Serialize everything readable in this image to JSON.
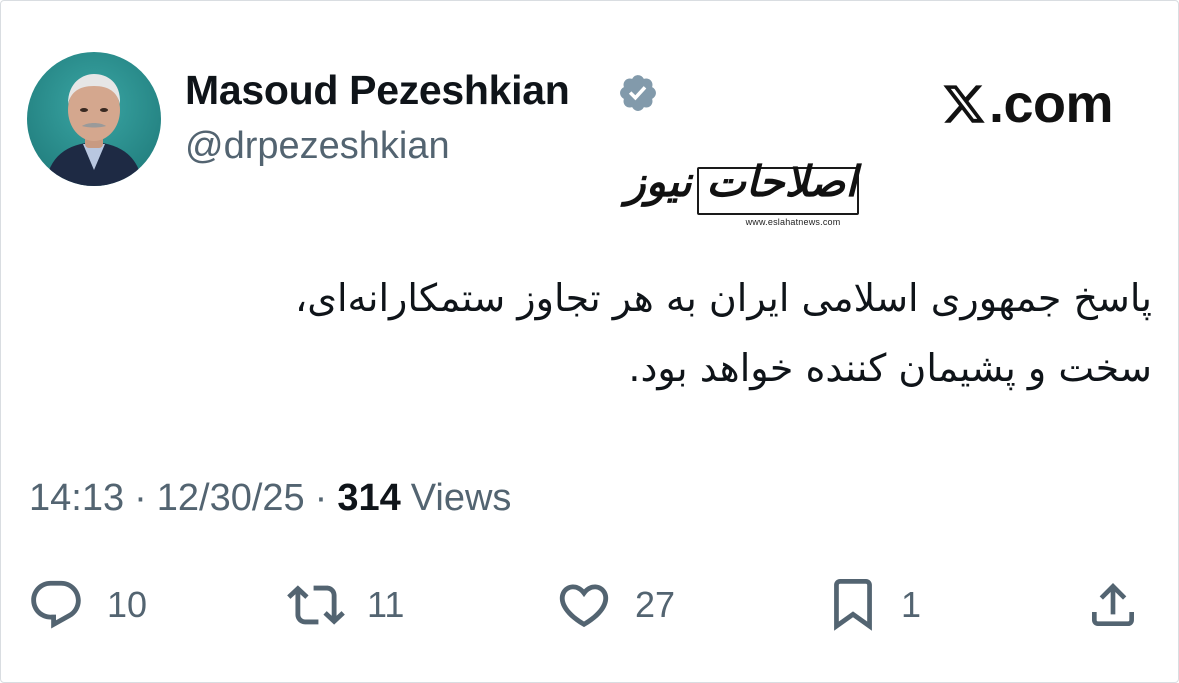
{
  "author": {
    "name": "Masoud Pezeshkian",
    "handle": "@drpezeshkian",
    "verified_color": "#829aab"
  },
  "brand": {
    "text": ".com",
    "logo_icon": "x-logo-icon"
  },
  "watermark": {
    "text": "اصلاحات نیوز",
    "url": "www.eslahatnews.com"
  },
  "tweet": {
    "lines": [
      "پاسخ جمهوری اسلامی ایران به هر تجاوز ستمکارانه‌ای،",
      "سخت و پشیمان کننده خواهد بود."
    ]
  },
  "meta": {
    "time": "14:13",
    "separator": "·",
    "date": "12/30/25",
    "views_count": "314",
    "views_label": "Views"
  },
  "actions": {
    "reply_count": "10",
    "retweet_count": "11",
    "like_count": "27",
    "bookmark_count": "1"
  },
  "colors": {
    "text_primary": "#0f1419",
    "text_secondary": "#536471",
    "avatar_bg": "#2a8f8f"
  }
}
